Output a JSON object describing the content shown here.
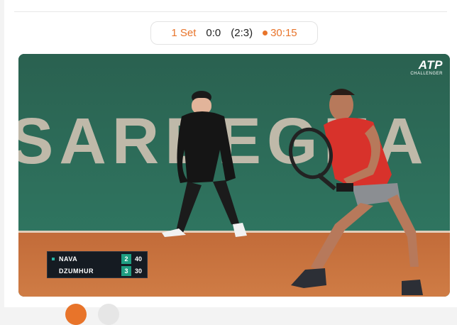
{
  "match": {
    "set_label": "1 Set",
    "score": "0:0",
    "games": "(2:3)",
    "live_points": "30:15"
  },
  "video": {
    "banner_text": "SARDEGNA",
    "logo_main": "ATP",
    "logo_sub": "CHALLENGER",
    "scoreboard": {
      "players": [
        {
          "name": "NAVA",
          "sets": "2",
          "points": "40",
          "serving": true
        },
        {
          "name": "DZUMHUR",
          "sets": "3",
          "points": "30",
          "serving": false
        }
      ]
    }
  },
  "colors": {
    "accent": "#e8742a",
    "court_clay": "#c8753f",
    "wall_green": "#2d6b57",
    "score_set_bg": "#1f9e82"
  }
}
